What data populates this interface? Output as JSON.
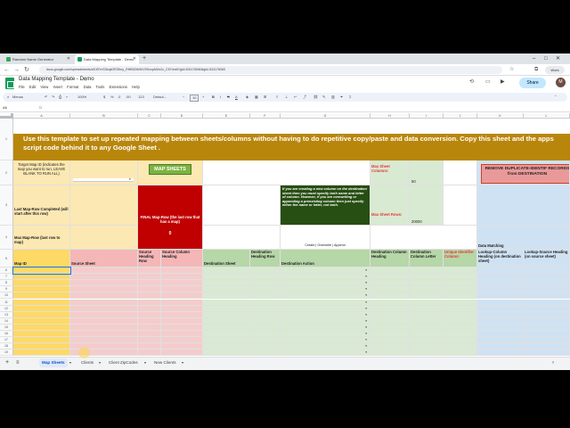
{
  "browser": {
    "tabs": [
      {
        "title": "Random Name Generator",
        "active": false
      },
      {
        "title": "Data Mapping Template - Demo",
        "active": true
      }
    ],
    "url": "docs.google.com/spreadsheets/d/1KFmS3eqkOR3Key_RHB9ZtbShV9SxnpMXe2c_C5Y/edit?gid=531176060#gid=531176060"
  },
  "doc": {
    "title": "Data Mapping Template - Demo",
    "menu": [
      "File",
      "Edit",
      "View",
      "Insert",
      "Format",
      "Data",
      "Tools",
      "Extensions",
      "Help"
    ],
    "share_label": "Share",
    "avatar_letter": "M"
  },
  "toolbar": {
    "search": "Menus",
    "zoom": "100%",
    "currency": "$",
    "percent": "%",
    "dec1": ".0",
    "dec2": ".00",
    "numfmt": "123",
    "font": "Defaul...",
    "size": "10"
  },
  "formula": {
    "cell_ref": "A6",
    "fx": "fx"
  },
  "columns": [
    "A",
    "B",
    "C",
    "D",
    "E",
    "F",
    "G",
    "H",
    "I",
    "J",
    "K",
    "L"
  ],
  "rows": [
    "1",
    "2",
    "3",
    "4",
    "5",
    "6",
    "7",
    "8",
    "9",
    "10",
    "11",
    "12",
    "13",
    "14",
    "15",
    "16",
    "17",
    "18",
    "19"
  ],
  "sheet": {
    "banner": "Use this template to set up repeated mapping between sheets/columns without having to do repetitive copy/paste and data conversion. Copy this sheet and the apps script code behind it to any Google Sheet .",
    "target_map_id": "Target Map ID (indicates the map you want to run, LEAVE BLANK TO RUN ALL)",
    "map_sheets_button": "MAP SHEETS",
    "max_sheet_columns_label": "Max Sheet Columns:",
    "max_sheet_columns_value": "50",
    "remove_duplicate": "REMOVE DUPLICATE-IDENTIF RECORDS from DESTINATION",
    "last_map_row": "Last Map-Row Completed (will start after this row)",
    "final_map_row": "FINAL Map-Row (the last row that has a map)",
    "final_map_row_value": "0",
    "note": "If you are creating a new column on the destination sheet then you must specify both name and letter of column. However, if you are overwriting or appending a preexisting column then just specify either the name or letter, not both.",
    "max_sheet_rows_label": "Max Sheet Rows:",
    "max_sheet_rows_value": "20000",
    "max_map_row": "Max Map-Row (last row to map)",
    "action_options": "Create | Overwrite | Append",
    "data_matching": "Data Matching",
    "headers": [
      "Map ID",
      "Source Sheet",
      "Source Heading Row",
      "Source Column Heading",
      "Destination Sheet",
      "Destination Heading Row",
      "Destination Action",
      "Destination Column Heading",
      "Destination Column Letter",
      "Unique Identifier Column:",
      "Lookup-Column Heading (on destination sheet)",
      "Lookup-Source Heading (on source sheet)"
    ]
  },
  "sheet_tabs": [
    "Map Sheets",
    "Clients",
    "Client ZipCodes",
    "New Clients"
  ]
}
